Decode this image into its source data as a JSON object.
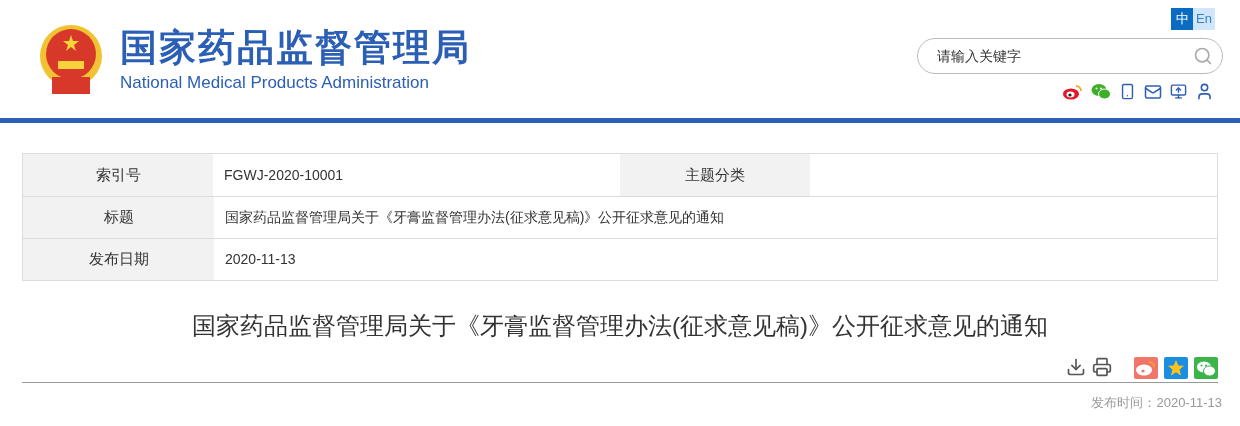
{
  "header": {
    "title": "国家药品监督管理局",
    "subtitle": "National Medical Products Administration",
    "languages": [
      {
        "label": "中",
        "selected": true
      },
      {
        "label": "En",
        "selected": false
      }
    ],
    "search": {
      "placeholder": "请输入关键字"
    }
  },
  "info_table": {
    "rows": [
      {
        "cells": [
          {
            "label": "索引号",
            "value": "FGWJ-2020-10001"
          },
          {
            "label": "主题分类"
          }
        ]
      },
      {
        "cells": [
          {
            "label": "标题",
            "value": "国家药品监督管理局关于《牙膏监督管理办法(征求意见稿)》公开征求意见的通知"
          }
        ]
      },
      {
        "cells": [
          {
            "label": "发布日期",
            "value": "2020-11-13"
          }
        ]
      }
    ]
  },
  "article": {
    "title": "国家药品监督管理局关于《牙膏监督管理办法(征求意见稿)》公开征求意见的通知",
    "publish_time": "发布时间：2020-11-13"
  }
}
